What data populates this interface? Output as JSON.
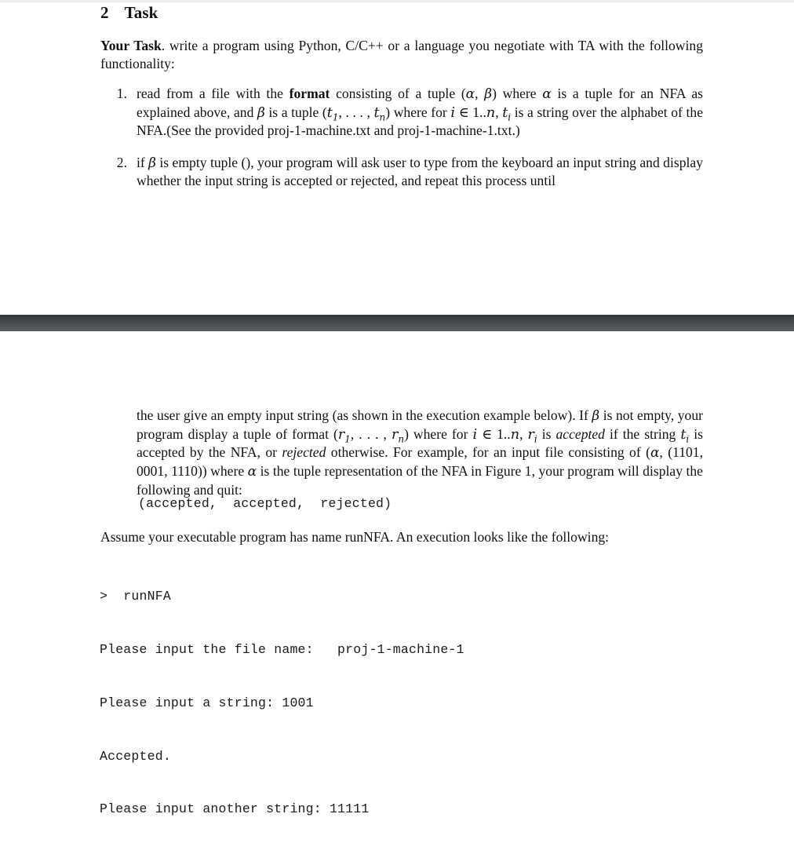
{
  "document": {
    "section": {
      "number": "2",
      "title": "Task"
    },
    "intro": {
      "lead_bold": "Your Task",
      "text_after_lead": ". write a program using Python, C/C++ or a language you negotiate with TA with the following functionality:"
    },
    "list": [
      {
        "marker": "1.",
        "text_part1": "read from a file with the ",
        "bold1": "format",
        "text_part2": " consisting of a tuple (",
        "alpha1": "α",
        "text_part3": ", ",
        "beta1": "β",
        "text_part4": ") where ",
        "alpha2": "α",
        "text_part5": " is a tuple for an NFA as explained above, and ",
        "beta2": "β",
        "text_part6": " is a tuple (",
        "t1": "t",
        "t1sub": "1",
        "text_part7": ", . . . , ",
        "tn": "t",
        "tnsub": "n",
        "text_part8": ") where for ",
        "i1": "i",
        "text_part9": " ∈ 1..",
        "n1": "n",
        "text_part10": ", ",
        "ti": "t",
        "tisub": "i",
        "text_part11": " is a string over the alphabet of the NFA.(See the provided proj-1-machine.txt and proj-1-machine-1.txt.)"
      },
      {
        "marker": "2.",
        "text_part1": "if ",
        "beta1": "β",
        "text_part2": " is empty tuple (), your program will ask user to type from the keyboard an input string and display whether the input string is accepted or rejected, and repeat this process until"
      }
    ],
    "continuation": {
      "p1_a": "the user give an empty input string (as shown in the execution example below). If ",
      "p1_beta": "β",
      "p1_b": " is not empty, your program display a tuple of format (",
      "p1_r1": "r",
      "p1_r1sub": "1",
      "p1_c": ", . . . , ",
      "p1_rn": "r",
      "p1_rnsub": "n",
      "p1_d": ") where for ",
      "p1_i": "i",
      "p1_e": " ∈ 1..",
      "p1_n": "n",
      "p1_f": ", ",
      "p1_ri": "r",
      "p1_risub": "i",
      "p1_g": " is ",
      "p1_accepted_italic": "accepted",
      "p1_h": " if the string ",
      "p1_t": "t",
      "p1_tsub": "i",
      "p1_i2": " is accepted by the NFA, or ",
      "p1_rejected_italic": "rejected",
      "p1_j": " otherwise.  For example, for an input file consisting of (",
      "p1_alpha": "α",
      "p1_k": ", (1101, 0001, 1110)) where ",
      "p1_alpha2": "α",
      "p1_l": " is the tuple representation of the NFA in Figure 1, your program will display the following and quit:"
    },
    "code_output": "(accepted,  accepted,  rejected)",
    "assume_line": "Assume your executable program has name runNFA. An execution looks like the following:",
    "terminal_lines": [
      ">  runNFA",
      "Please input the file name:   proj-1-machine-1",
      "Please input a string: 1001",
      "Accepted.",
      "Please input another string: 11111"
    ]
  },
  "colors": {
    "band_top": "#34383c",
    "band_bottom": "#595d62",
    "top_strip": "#eeeeee",
    "text": "#111111",
    "page_background": "#ffffff"
  }
}
